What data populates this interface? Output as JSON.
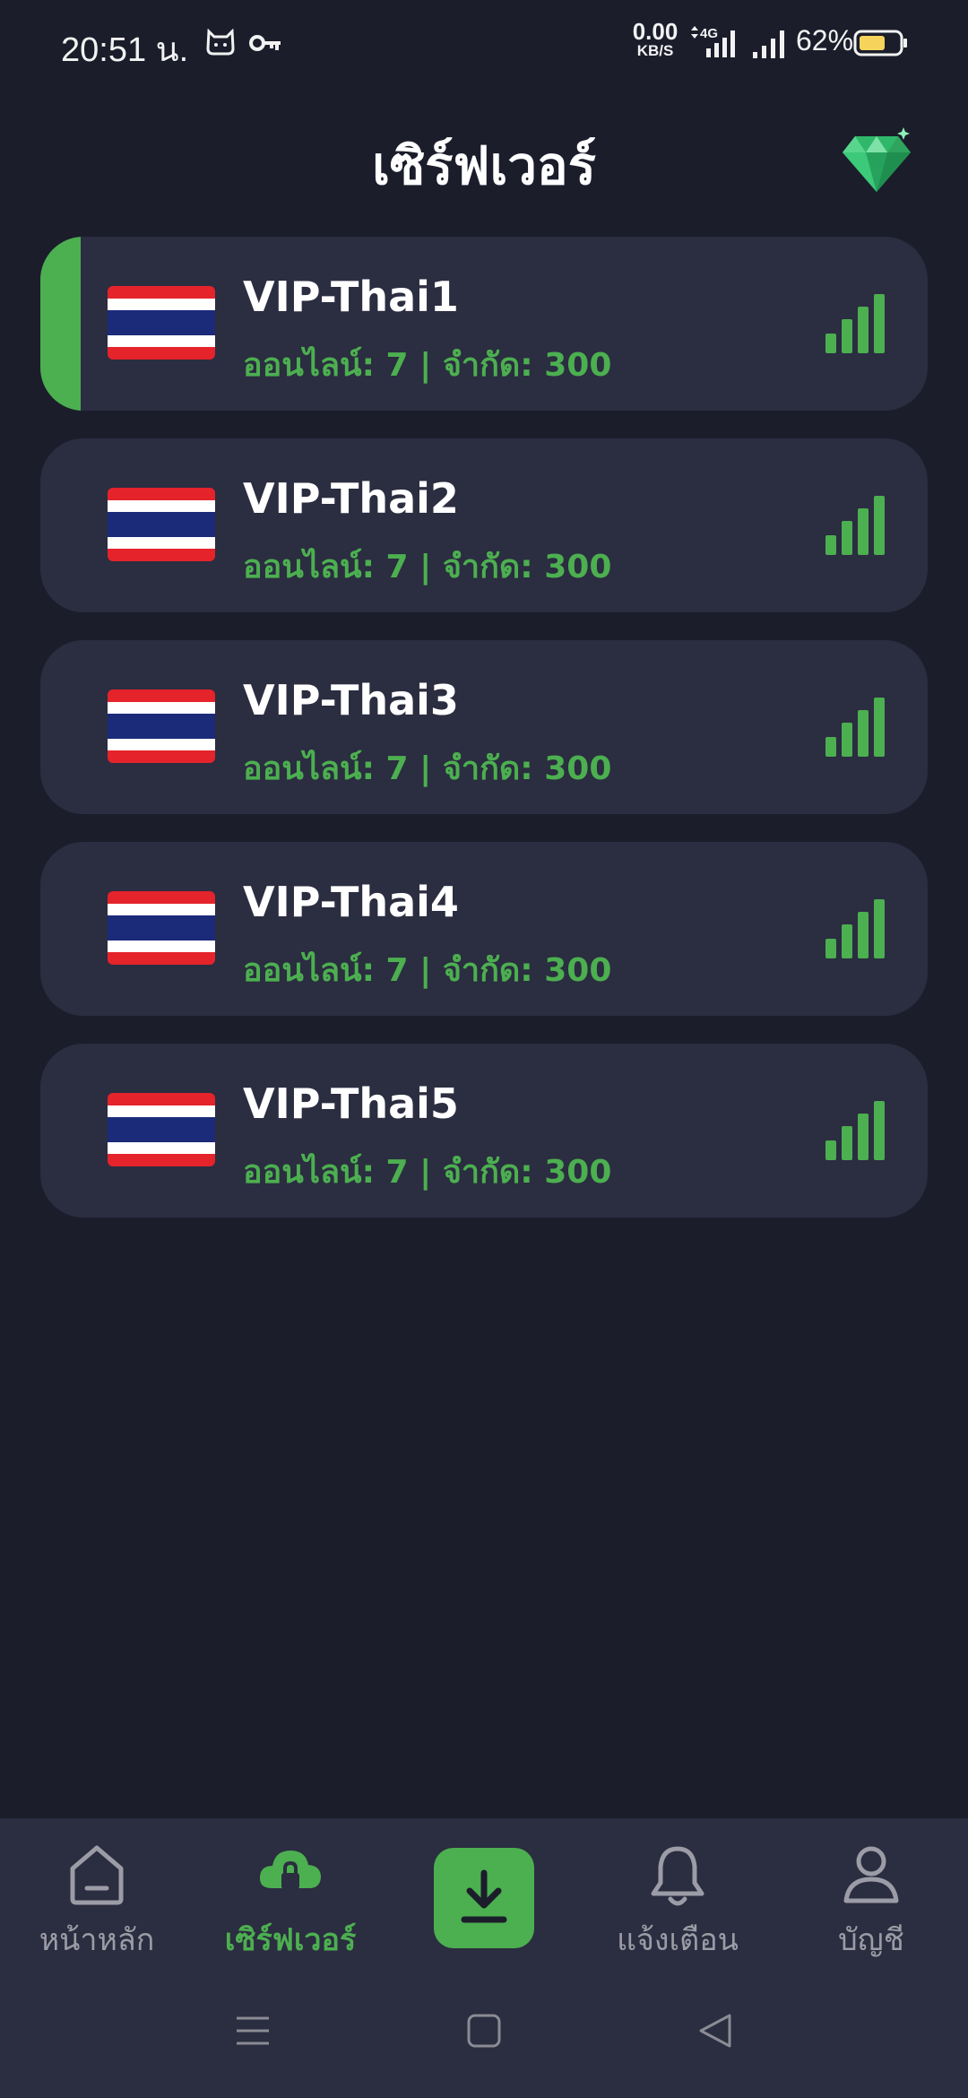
{
  "status_bar": {
    "time": "20:51 น.",
    "net_speed_value": "0.00",
    "net_speed_unit": "KB/S",
    "network_type": "4G",
    "battery_percent": "62%",
    "icons": [
      "cat-app-icon",
      "vpn-key-icon",
      "data-activity-icon",
      "signal-icon",
      "signal-icon",
      "battery-icon"
    ]
  },
  "header": {
    "title": "เซิร์ฟเวอร์",
    "premium_icon": "diamond-icon"
  },
  "servers": [
    {
      "name": "VIP-Thai1",
      "status": "ออนไลน์: 7 | จำกัด: 300",
      "selected": true,
      "signal_level": 4
    },
    {
      "name": "VIP-Thai2",
      "status": "ออนไลน์: 7 | จำกัด: 300",
      "selected": false,
      "signal_level": 4
    },
    {
      "name": "VIP-Thai3",
      "status": "ออนไลน์: 7 | จำกัด: 300",
      "selected": false,
      "signal_level": 4
    },
    {
      "name": "VIP-Thai4",
      "status": "ออนไลน์: 7 | จำกัด: 300",
      "selected": false,
      "signal_level": 4
    },
    {
      "name": "VIP-Thai5",
      "status": "ออนไลน์: 7 | จำกัด: 300",
      "selected": false,
      "signal_level": 4
    }
  ],
  "bottom_nav": {
    "home": "หน้าหลัก",
    "servers": "เซิร์ฟเวอร์",
    "download_icon": "download-icon",
    "notifications": "แจ้งเตือน",
    "account": "บัญชี"
  },
  "colors": {
    "background": "#1b1d2b",
    "card": "#2b2d40",
    "accent": "#4caf50",
    "inactive": "#9b9ca6"
  }
}
